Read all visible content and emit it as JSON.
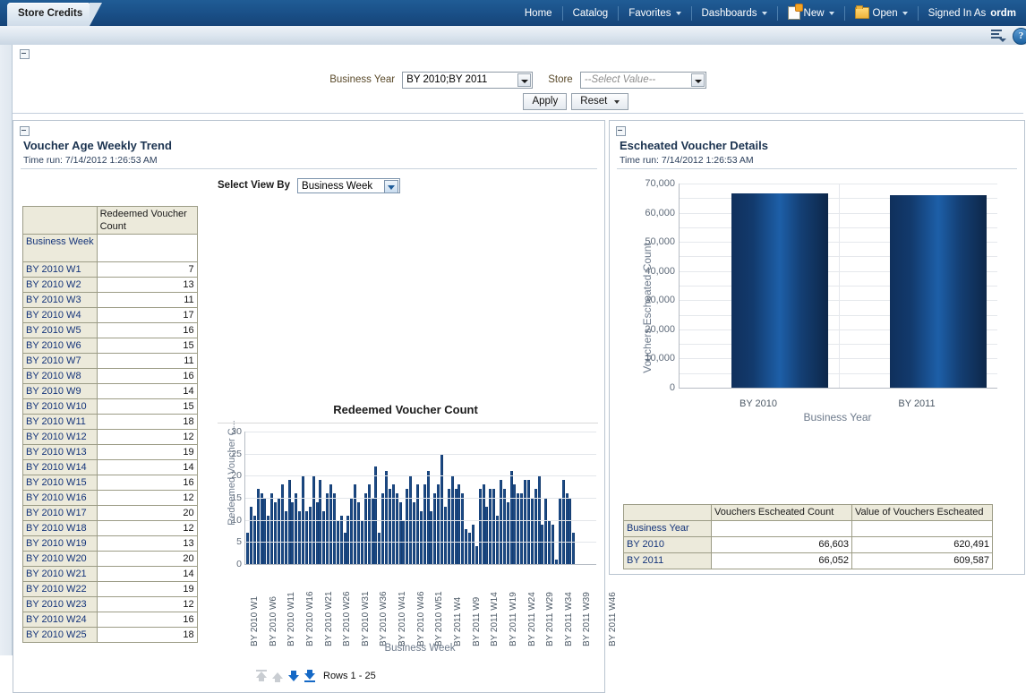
{
  "window": {
    "tab_label": "Store Credits"
  },
  "nav": {
    "items": [
      {
        "label": "Home",
        "caret": false,
        "icon": null
      },
      {
        "label": "Catalog",
        "caret": false,
        "icon": null
      },
      {
        "label": "Favorites",
        "caret": true,
        "icon": null
      },
      {
        "label": "Dashboards",
        "caret": true,
        "icon": null
      },
      {
        "label": "New",
        "caret": true,
        "icon": "new-page-icon"
      },
      {
        "label": "Open",
        "caret": true,
        "icon": "open-folder-icon"
      }
    ],
    "signed_in_label": "Signed In As",
    "signed_in_user": "ordm",
    "page_options_icon": "page-options-icon",
    "help_icon_glyph": "?"
  },
  "prompts": {
    "business_year_label": "Business Year",
    "business_year_value": "BY 2010;BY 2011",
    "store_label": "Store",
    "store_value": "--Select Value--",
    "apply_label": "Apply",
    "reset_label": "Reset"
  },
  "left_panel": {
    "title": "Voucher Age Weekly Trend",
    "time_run": "Time run: 7/14/2012 1:26:53 AM",
    "view_by_label": "Select View By",
    "view_by_value": "Business Week",
    "table": {
      "corner_header": "",
      "measure_header": "Redeemed Voucher Count",
      "row_dim_header": "Business Week",
      "rows": [
        {
          "label": "BY 2010 W1",
          "value": "7"
        },
        {
          "label": "BY 2010 W2",
          "value": "13"
        },
        {
          "label": "BY 2010 W3",
          "value": "11"
        },
        {
          "label": "BY 2010 W4",
          "value": "17"
        },
        {
          "label": "BY 2010 W5",
          "value": "16"
        },
        {
          "label": "BY 2010 W6",
          "value": "15"
        },
        {
          "label": "BY 2010 W7",
          "value": "11"
        },
        {
          "label": "BY 2010 W8",
          "value": "16"
        },
        {
          "label": "BY 2010 W9",
          "value": "14"
        },
        {
          "label": "BY 2010 W10",
          "value": "15"
        },
        {
          "label": "BY 2010 W11",
          "value": "18"
        },
        {
          "label": "BY 2010 W12",
          "value": "12"
        },
        {
          "label": "BY 2010 W13",
          "value": "19"
        },
        {
          "label": "BY 2010 W14",
          "value": "14"
        },
        {
          "label": "BY 2010 W15",
          "value": "16"
        },
        {
          "label": "BY 2010 W16",
          "value": "12"
        },
        {
          "label": "BY 2010 W17",
          "value": "20"
        },
        {
          "label": "BY 2010 W18",
          "value": "12"
        },
        {
          "label": "BY 2010 W19",
          "value": "13"
        },
        {
          "label": "BY 2010 W20",
          "value": "20"
        },
        {
          "label": "BY 2010 W21",
          "value": "14"
        },
        {
          "label": "BY 2010 W22",
          "value": "19"
        },
        {
          "label": "BY 2010 W23",
          "value": "12"
        },
        {
          "label": "BY 2010 W24",
          "value": "16"
        },
        {
          "label": "BY 2010 W25",
          "value": "18"
        }
      ]
    },
    "pager": {
      "rows_label": "Rows 1 - 25",
      "first_icon": "first-page-arrow-icon",
      "prev_icon": "previous-page-arrow-icon",
      "next_icon": "next-page-arrow-icon",
      "last_icon": "last-page-arrow-icon"
    }
  },
  "right_panel": {
    "title": "Escheated Voucher Details",
    "time_run": "Time run: 7/14/2012 1:26:53 AM",
    "table": {
      "col_headers": [
        "Vouchers Escheated Count",
        "Value of Vouchers Escheated"
      ],
      "row_dim_header": "Business Year",
      "rows": [
        {
          "label": "BY 2010",
          "count": "66,603",
          "value": "620,491"
        },
        {
          "label": "BY 2011",
          "count": "66,052",
          "value": "609,587"
        }
      ]
    }
  },
  "colors": {
    "nav_blue": "#1a5088",
    "bar_navy": "#163e72",
    "link_blue": "#14347a",
    "header_beige": "#eceadb",
    "axis_label_gray": "#6e7b8c"
  },
  "chart_data": [
    {
      "id": "redeemed-voucher-count-chart",
      "type": "bar",
      "title": "Redeemed Voucher Count",
      "xlabel": "Business Week",
      "ylabel": "Redeemed Voucher C...",
      "ylim": [
        0,
        30
      ],
      "yticks": [
        0,
        5,
        10,
        15,
        20,
        25,
        30
      ],
      "grid": true,
      "legend": false,
      "xtick_labels": [
        "BY 2010 W1",
        "BY 2010 W6",
        "BY 2010 W11",
        "BY 2010 W16",
        "BY 2010 W21",
        "BY 2010 W26",
        "BY 2010 W31",
        "BY 2010 W36",
        "BY 2010 W41",
        "BY 2010 W46",
        "BY 2010 W51",
        "BY 2011 W4",
        "BY 2011 W9",
        "BY 2011 W14",
        "BY 2011 W19",
        "BY 2011 W24",
        "BY 2011 W29",
        "BY 2011 W34",
        "BY 2011 W39",
        "BY 2011 W46"
      ],
      "xtick_positions": [
        0,
        5,
        10,
        15,
        20,
        25,
        30,
        35,
        40,
        45,
        50,
        55,
        60,
        65,
        70,
        75,
        80,
        85,
        90,
        97
      ],
      "values": [
        7,
        13,
        11,
        17,
        16,
        15,
        11,
        16,
        14,
        15,
        18,
        12,
        19,
        14,
        16,
        12,
        20,
        12,
        13,
        20,
        14,
        19,
        12,
        16,
        18,
        16,
        10,
        11,
        7,
        11,
        15,
        18,
        14,
        10,
        16,
        18,
        15,
        22,
        7,
        16,
        21,
        17,
        18,
        16,
        14,
        10,
        17,
        20,
        14,
        18,
        12,
        18,
        21,
        12,
        16,
        18,
        25,
        13,
        17,
        20,
        17,
        18,
        16,
        8,
        7,
        9,
        4,
        17,
        18,
        13,
        17,
        17,
        11,
        19,
        17,
        14,
        21,
        18,
        16,
        16,
        19,
        19,
        15,
        17,
        20,
        9,
        15,
        10,
        9,
        1,
        15,
        19,
        16,
        15,
        7
      ]
    },
    {
      "id": "vouchers-escheated-chart",
      "type": "bar",
      "title": "",
      "xlabel": "Business Year",
      "ylabel": "Vouchers Escheated Count",
      "ylim": [
        0,
        70000
      ],
      "yticks": [
        0,
        10000,
        20000,
        30000,
        40000,
        50000,
        60000,
        70000
      ],
      "ytick_labels": [
        "0",
        "10,000",
        "20,000",
        "30,000",
        "40,000",
        "50,000",
        "60,000",
        "70,000"
      ],
      "grid": true,
      "legend": false,
      "categories": [
        "BY 2010",
        "BY 2011"
      ],
      "values": [
        66603,
        66052
      ]
    }
  ]
}
